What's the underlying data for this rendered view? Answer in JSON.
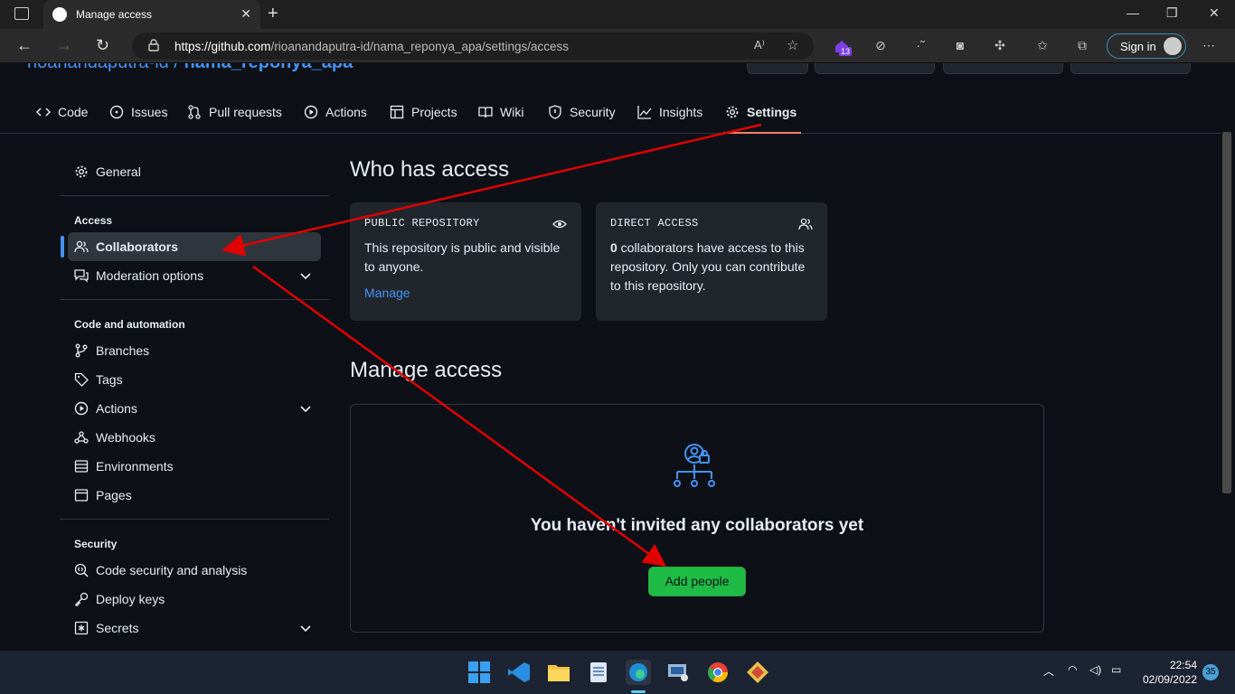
{
  "browser": {
    "tab_title": "Manage access",
    "url_host": "https://github.com",
    "url_path": "/rioanandaputra-id/nama_reponya_apa/settings/access",
    "signin_label": "Sign in",
    "ext_badge": "13"
  },
  "repo": {
    "owner": "rioanandaputra-id",
    "separator": "/",
    "name": "nama_reponya_apa"
  },
  "reponav": {
    "code": "Code",
    "issues": "Issues",
    "pull_requests": "Pull requests",
    "actions": "Actions",
    "projects": "Projects",
    "wiki": "Wiki",
    "security": "Security",
    "insights": "Insights",
    "settings": "Settings"
  },
  "sidebar": {
    "general": "General",
    "access_heading": "Access",
    "collaborators": "Collaborators",
    "moderation": "Moderation options",
    "code_heading": "Code and automation",
    "branches": "Branches",
    "tags": "Tags",
    "actions": "Actions",
    "webhooks": "Webhooks",
    "environments": "Environments",
    "pages": "Pages",
    "security_heading": "Security",
    "code_security": "Code security and analysis",
    "deploy_keys": "Deploy keys",
    "secrets": "Secrets"
  },
  "main": {
    "who_title": "Who has access",
    "public_title": "PUBLIC REPOSITORY",
    "public_body": "This repository is public and visible to anyone.",
    "manage_link": "Manage",
    "direct_title": "DIRECT ACCESS",
    "direct_count": "0",
    "direct_body": " collaborators have access to this repository. Only you can contribute to this repository.",
    "manage_title": "Manage access",
    "empty_msg": "You haven't invited any collaborators yet",
    "add_people": "Add people"
  },
  "taskbar": {
    "time": "22:54",
    "date": "02/09/2022",
    "notif": "35"
  },
  "colors": {
    "accent_blue": "#4493f8",
    "arrow_red": "#e00000",
    "add_green": "#1ebc45"
  }
}
